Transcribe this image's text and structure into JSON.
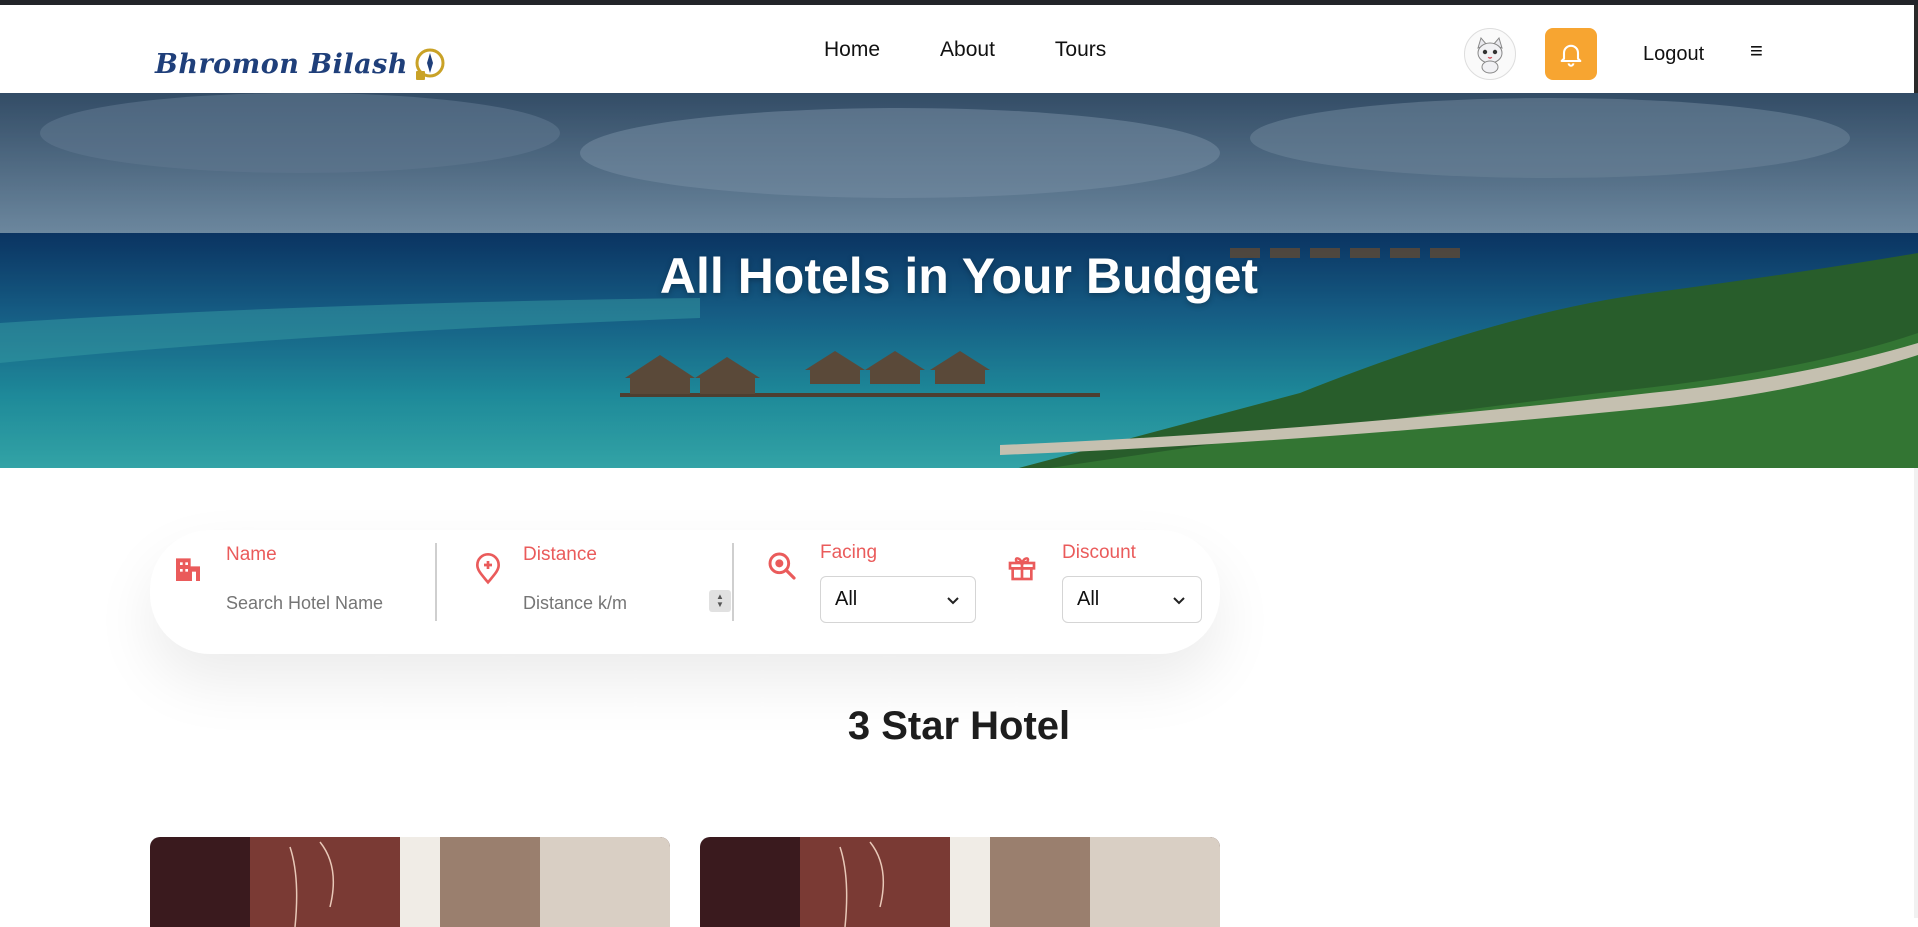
{
  "brand": {
    "logo_text": "Bhromon Bilash"
  },
  "nav": {
    "links": [
      "Home",
      "About",
      "Tours"
    ],
    "logout_label": "Logout",
    "menu_glyph": "≡"
  },
  "hero": {
    "title": "All Hotels in Your Budget"
  },
  "search": {
    "name": {
      "label": "Name",
      "placeholder": "Search Hotel Name",
      "icon": "building-icon"
    },
    "distance": {
      "label": "Distance",
      "placeholder": "Distance k/m",
      "icon": "map-pin-plus-icon"
    },
    "facing": {
      "label": "Facing",
      "value": "All",
      "icon": "search-focus-icon"
    },
    "discount": {
      "label": "Discount",
      "value": "All",
      "icon": "gift-icon"
    }
  },
  "section": {
    "title": "3 Star Hotel"
  },
  "colors": {
    "accent": "#ea5b5b",
    "bell_bg": "#f7a531",
    "topline": "#222429"
  }
}
